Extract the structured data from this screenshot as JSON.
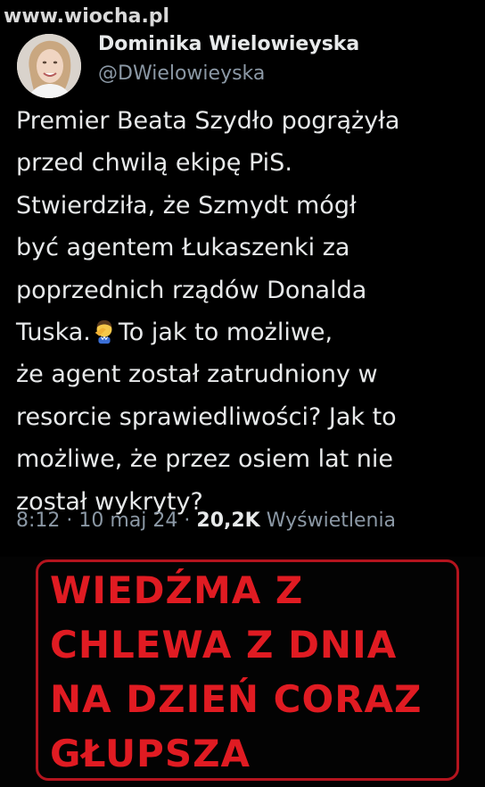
{
  "watermark": "www.wiocha.pl",
  "author": {
    "display_name": "Dominika Wielowieyska",
    "handle": "@DWielowieyska"
  },
  "tweet": {
    "lines": [
      "Premier Beata Szydło pogrążyła",
      "przed chwilą ekipę PiS.",
      "Stwierdziła, że Szmydt mógł",
      "być agentem Łukaszenki za",
      "poprzednich rządów Donalda"
    ],
    "line6_before": "Tuska.",
    "line6_after": "To jak to możliwe,",
    "lines_after": [
      "że agent został zatrudniony w",
      "resorcie sprawiedliwości? Jak to",
      "możliwe, że przez osiem lat nie",
      "został wykryty?"
    ],
    "emoji_icon": "facepalm-emoji"
  },
  "meta": {
    "time": "8:12",
    "separator": "·",
    "date": "10 maj 24",
    "views_count": "20,2K",
    "views_label": "Wyświetlenia"
  },
  "banner": {
    "lines": [
      "WIEDŹMA Z",
      "CHLEWA Z DNIA",
      "NA DZIEŃ CORAZ",
      "GŁUPSZA"
    ]
  },
  "colors": {
    "background": "#000000",
    "text_primary": "#e7e9ea",
    "text_secondary": "#8b98a5",
    "banner_red": "#e01b22"
  }
}
